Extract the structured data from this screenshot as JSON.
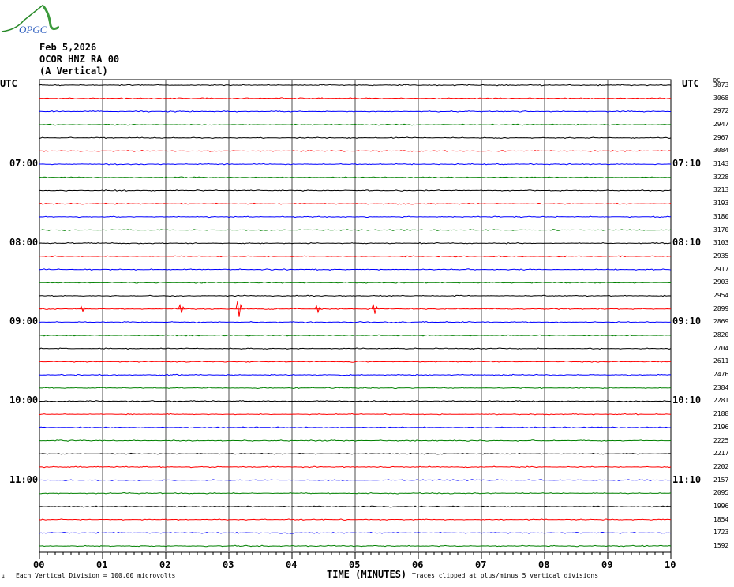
{
  "logo": {
    "text": "OPGC"
  },
  "header": {
    "date": "Feb 5,2026",
    "station": "OCOR HNZ RA 00",
    "component": "(A Vertical)"
  },
  "utc_label_left": "UTC",
  "utc_label_right": "UTC",
  "dc_label": "DC",
  "trace_colors": [
    "#000000",
    "#ff0000",
    "#0000ff",
    "#008000"
  ],
  "left_time_labels": [
    {
      "trace": 6,
      "text": "07:00"
    },
    {
      "trace": 12,
      "text": "08:00"
    },
    {
      "trace": 18,
      "text": "09:00"
    },
    {
      "trace": 24,
      "text": "10:00"
    },
    {
      "trace": 30,
      "text": "11:00"
    }
  ],
  "right_time_labels": [
    {
      "trace": 6,
      "text": "07:10"
    },
    {
      "trace": 12,
      "text": "08:10"
    },
    {
      "trace": 18,
      "text": "09:10"
    },
    {
      "trace": 24,
      "text": "10:10"
    },
    {
      "trace": 30,
      "text": "11:10"
    }
  ],
  "dc_values": [
    "3073",
    "3068",
    "2972",
    "2947",
    "2967",
    "3084",
    "3143",
    "3228",
    "3213",
    "3193",
    "3180",
    "3170",
    "3103",
    "2935",
    "2917",
    "2903",
    "2954",
    "2899",
    "2869",
    "2820",
    "2704",
    "2611",
    "2476",
    "2384",
    "2281",
    "2188",
    "2196",
    "2225",
    "2217",
    "2202",
    "2157",
    "2095",
    "1996",
    "1854",
    "1723",
    "1592"
  ],
  "x_ticks": [
    "00",
    "01",
    "02",
    "03",
    "04",
    "05",
    "06",
    "07",
    "08",
    "09",
    "10"
  ],
  "footer": {
    "scale_text": "Each Vertical Division =  100.00 microvolts",
    "axis_title": "TIME (MINUTES)",
    "clip_text": "Traces clipped at plus/minus 5 vertical divisions"
  }
}
